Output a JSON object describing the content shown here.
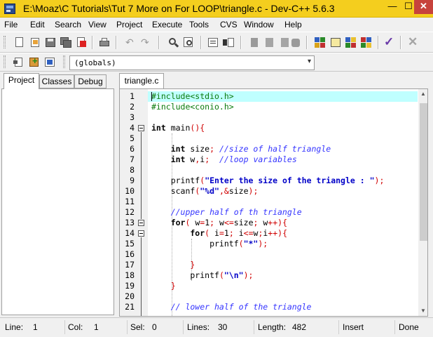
{
  "window": {
    "title": "E:\\Moaz\\C Tutorials\\Tut 7 More on For LOOP\\triangle.c - Dev-C++ 5.6.3",
    "controls": {
      "minimize": "—",
      "maximize": "☐",
      "close": "✕"
    }
  },
  "menu": [
    "File",
    "Edit",
    "Search",
    "View",
    "Project",
    "Execute",
    "Tools",
    "CVS",
    "Window",
    "Help"
  ],
  "toolbar": {
    "scope_combo_value": "(globals)",
    "combo_arrow": "▾"
  },
  "left_panel": {
    "tabs": [
      "Project",
      "Classes",
      "Debug"
    ],
    "active_tab": "Project"
  },
  "editor": {
    "active_tab": "triangle.c",
    "line_numbers": [
      "1",
      "2",
      "3",
      "4",
      "5",
      "6",
      "7",
      "8",
      "9",
      "10",
      "11",
      "12",
      "13",
      "14",
      "15",
      "16",
      "17",
      "18",
      "19",
      "20",
      "21"
    ],
    "code": {
      "l1": {
        "a": "#include<stdio.h>"
      },
      "l2": {
        "a": "#include<conio.h>"
      },
      "l4": {
        "a": "int",
        "b": " main",
        "c": "(){"
      },
      "l6": {
        "a": "    int",
        "b": " size",
        "c": ";",
        "d": " //size of half triangle"
      },
      "l7": {
        "a": "    int",
        "b": " w",
        "c": ",",
        "d": "i",
        "e": ";",
        "f": "  //loop variables"
      },
      "l9": {
        "a": "    printf",
        "b": "(",
        "c": "\"Enter the size of the triangle : \"",
        "d": ");"
      },
      "l10": {
        "a": "    scanf",
        "b": "(",
        "c": "\"%d\"",
        "d": ",&",
        "e": "size",
        "f": ");"
      },
      "l12": {
        "a": "    //upper half of th triangle"
      },
      "l13": {
        "a": "    for",
        "b": "(",
        "c": " w",
        "d": "=",
        "e": "1",
        "f": ";",
        "g": " w",
        "h": "<=",
        "i": "size",
        "j": ";",
        "k": " w",
        "l": "++){"
      },
      "l14": {
        "a": "        for",
        "b": "(",
        "c": " i",
        "d": "=",
        "e": "1",
        "f": ";",
        "g": " i",
        "h": "<=",
        "i": "w",
        "j": ";",
        "k": "i",
        "l": "++){"
      },
      "l15": {
        "a": "            printf",
        "b": "(",
        "c": "\"*\"",
        "d": ");"
      },
      "l17": {
        "a": "        }"
      },
      "l18": {
        "a": "        printf",
        "b": "(",
        "c": "\"\\n\"",
        "d": ");"
      },
      "l19": {
        "a": "    }"
      },
      "l21": {
        "a": "    // lower half of the triangle"
      }
    }
  },
  "status": {
    "line_label": "Line:",
    "line_value": "1",
    "col_label": "Col:",
    "col_value": "1",
    "sel_label": "Sel:",
    "sel_value": "0",
    "lines_label": "Lines:",
    "lines_value": "30",
    "length_label": "Length:",
    "length_value": "482",
    "mode": "Insert",
    "state": "Done"
  }
}
